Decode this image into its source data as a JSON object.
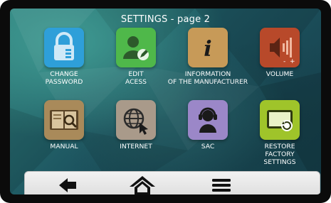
{
  "title": "SETTINGS - page 2",
  "tiles": [
    {
      "id": "change-password",
      "label": "CHANGE\nPASSWORD",
      "icon": "lock-icon",
      "color": "#2e9fd9"
    },
    {
      "id": "edit-access",
      "label": "EDIT\nACESS",
      "icon": "user-edit-icon",
      "color": "#4fb84a"
    },
    {
      "id": "manufacturer",
      "label": "INFORMATION\nOF THE MANUFACTURER",
      "icon": "info-icon",
      "color": "#c79a58"
    },
    {
      "id": "volume",
      "label": "VOLUME",
      "icon": "volume-icon",
      "color": "#b8492a"
    },
    {
      "id": "manual",
      "label": "MANUAL",
      "icon": "manual-book-icon",
      "color": "#a98a5a"
    },
    {
      "id": "internet",
      "label": "INTERNET",
      "icon": "globe-icon",
      "color": "#a99a8a"
    },
    {
      "id": "sac",
      "label": "SAC",
      "icon": "headset-icon",
      "color": "#9b87c8"
    },
    {
      "id": "restore",
      "label": "RESTORE\nFACTORY\nSETTINGS",
      "icon": "restore-icon",
      "color": "#9fc42a"
    }
  ],
  "nav": [
    {
      "id": "back",
      "icon": "back-arrow-icon"
    },
    {
      "id": "home",
      "icon": "home-icon"
    },
    {
      "id": "menu",
      "icon": "hamburger-menu-icon"
    }
  ]
}
